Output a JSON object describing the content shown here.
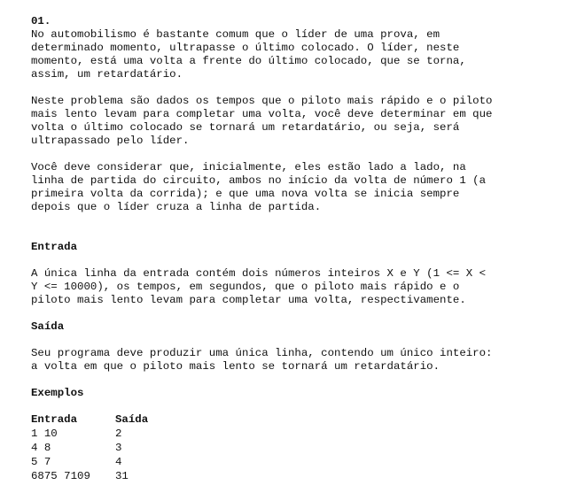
{
  "problem": {
    "title": "01.",
    "paragraphs": [
      "No automobilismo é bastante comum que o líder de uma prova, em\ndeterminado momento, ultrapasse o último colocado. O líder, neste\nmomento, está uma volta a frente do último colocado, que se torna,\nassim, um retardatário.",
      "Neste problema são dados os tempos que o piloto mais rápido e o piloto\nmais lento levam para completar uma volta, você deve determinar em que\nvolta o último colocado se tornará um retardatário, ou seja, será\nultrapassado pelo líder.",
      "Você deve considerar que, inicialmente, eles estão lado a lado, na\nlinha de partida do circuito, ambos no início da volta de número 1 (a\nprimeira volta da corrida); e que uma nova volta se inicia sempre\ndepois que o líder cruza a linha de partida."
    ]
  },
  "input_section": {
    "heading": "Entrada",
    "text": "A única linha da entrada contém dois números inteiros X e Y (1 <= X <\nY <= 10000), os tempos, em segundos, que o piloto mais rápido e o\npiloto mais lento levam para completar uma volta, respectivamente."
  },
  "output_section": {
    "heading": "Saída",
    "text": "Seu programa deve produzir uma única linha, contendo um único inteiro:\na volta em que o piloto mais lento se tornará um retardatário."
  },
  "examples": {
    "heading": "Exemplos",
    "columns": [
      "Entrada",
      "Saída"
    ],
    "rows": [
      [
        "1 10",
        "2"
      ],
      [
        "4 8",
        "3"
      ],
      [
        "5 7",
        "4"
      ],
      [
        "6875 7109",
        "31"
      ]
    ]
  }
}
